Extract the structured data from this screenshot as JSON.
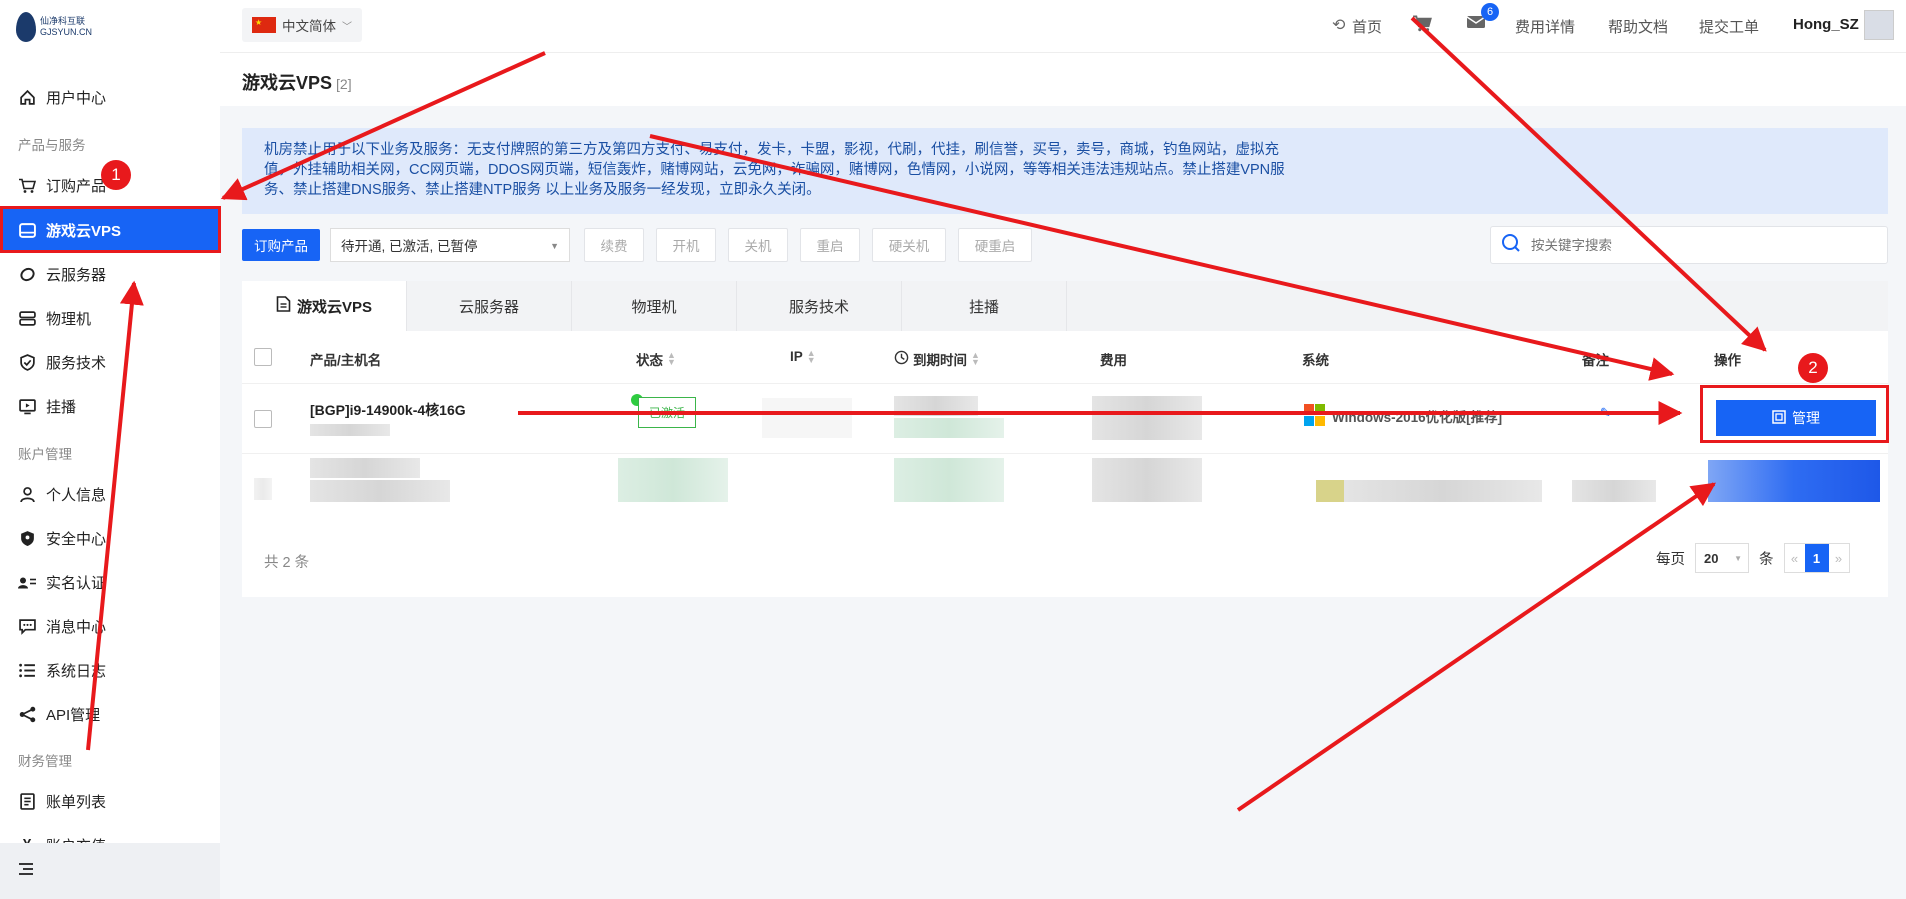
{
  "logo": {
    "text_line1": "仙净科互联",
    "text_line2": "GJSYUN.CN"
  },
  "topbar": {
    "language": "中文简体",
    "home": "首页",
    "messages_count": "6",
    "billing": "费用详情",
    "help": "帮助文档",
    "ticket": "提交工单",
    "username": "Hong_SZ"
  },
  "sidebar": {
    "user_center": "用户中心",
    "section_products": "产品与服务",
    "order_product": "订购产品",
    "game_vps": "游戏云VPS",
    "cloud_server": "云服务器",
    "physical": "物理机",
    "service_tech": "服务技术",
    "hang": "挂播",
    "section_account": "账户管理",
    "personal_info": "个人信息",
    "security": "安全中心",
    "realname": "实名认证",
    "messages": "消息中心",
    "syslog": "系统日志",
    "api": "API管理",
    "section_finance": "财务管理",
    "bills": "账单列表",
    "recharge": "账户充值"
  },
  "page": {
    "title": "游戏云VPS",
    "count": "[2]"
  },
  "notice": "机房禁止用于以下业务及服务：无支付牌照的第三方及第四方支付、易支付，发卡，卡盟，影视，代刷，代挂，刷信誉，买号，卖号，商城，钓鱼网站，虚拟充值，外挂辅助相关网，CC网页端，DDOS网页端，短信轰炸，赌博网站，云免网，诈骗网，赌博网，色情网，小说网，等等相关违法违规站点。禁止搭建VPN服务、禁止搭建DNS服务、禁止搭建NTP服务 以上业务及服务一经发现，立即永久关闭。",
  "toolbar": {
    "order_button": "订购产品",
    "status_filter": "待开通, 已激活, 已暂停",
    "renew": "续费",
    "start": "开机",
    "shutdown": "关机",
    "restart": "重启",
    "hard_shutdown": "硬关机",
    "hard_restart": "硬重启",
    "search_placeholder": "按关键字搜索"
  },
  "tabs": [
    "游戏云VPS",
    "云服务器",
    "物理机",
    "服务技术",
    "挂播"
  ],
  "table": {
    "headers": {
      "product": "产品/主机名",
      "status": "状态",
      "ip": "IP",
      "expire": "到期时间",
      "cost": "费用",
      "system": "系统",
      "remark": "备注",
      "action": "操作"
    },
    "row1": {
      "product": "[BGP]i9-14900k-4核16G",
      "status": "已激活",
      "system": "Windows-2016优化版[推荐]",
      "remark": "-",
      "action": "管理"
    }
  },
  "footer": {
    "total": "共 2 条",
    "per_page": "每页",
    "page_size": "20",
    "unit": "条",
    "prev": "«",
    "current_page": "1",
    "next": "»"
  },
  "annotations": {
    "marker1": "1",
    "marker2": "2"
  },
  "colors": {
    "primary": "#1764f5",
    "annotation_red": "#e8191c",
    "notice_bg": "#dfe9fb"
  }
}
